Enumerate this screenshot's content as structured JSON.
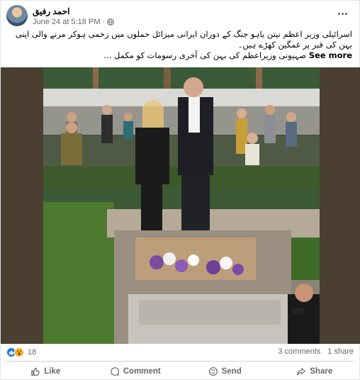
{
  "post": {
    "author": "احمد رفیق",
    "timestamp": "June 24 at 5:18 PM",
    "dot": "·",
    "caption_line1": "اسرائیلی وزیر اعظم نیتن یاہو جنگ کے دوران ایرانی میزائل حملوں میں زخمی ہوکر مرنے والی اپنی بہن کی قبر پر غمگین کھڑے ہیں۔",
    "caption_line2": "صہیونی وزیراعظم کی بہن کی آخری رسومات کو مکمل ...",
    "see_more": "See more"
  },
  "stats": {
    "reaction_count": "18",
    "comments": "3 comments",
    "shares": "1 share"
  },
  "actions": {
    "like": "Like",
    "comment": "Comment",
    "send": "Send",
    "share": "Share"
  },
  "icons": [
    "globe-icon",
    "more-icon",
    "like-reaction-icon",
    "wow-reaction-icon",
    "like-icon",
    "comment-icon",
    "send-icon",
    "share-icon"
  ],
  "colors": {
    "link_blue": "#1877f2",
    "secondary_text": "#65676b"
  }
}
